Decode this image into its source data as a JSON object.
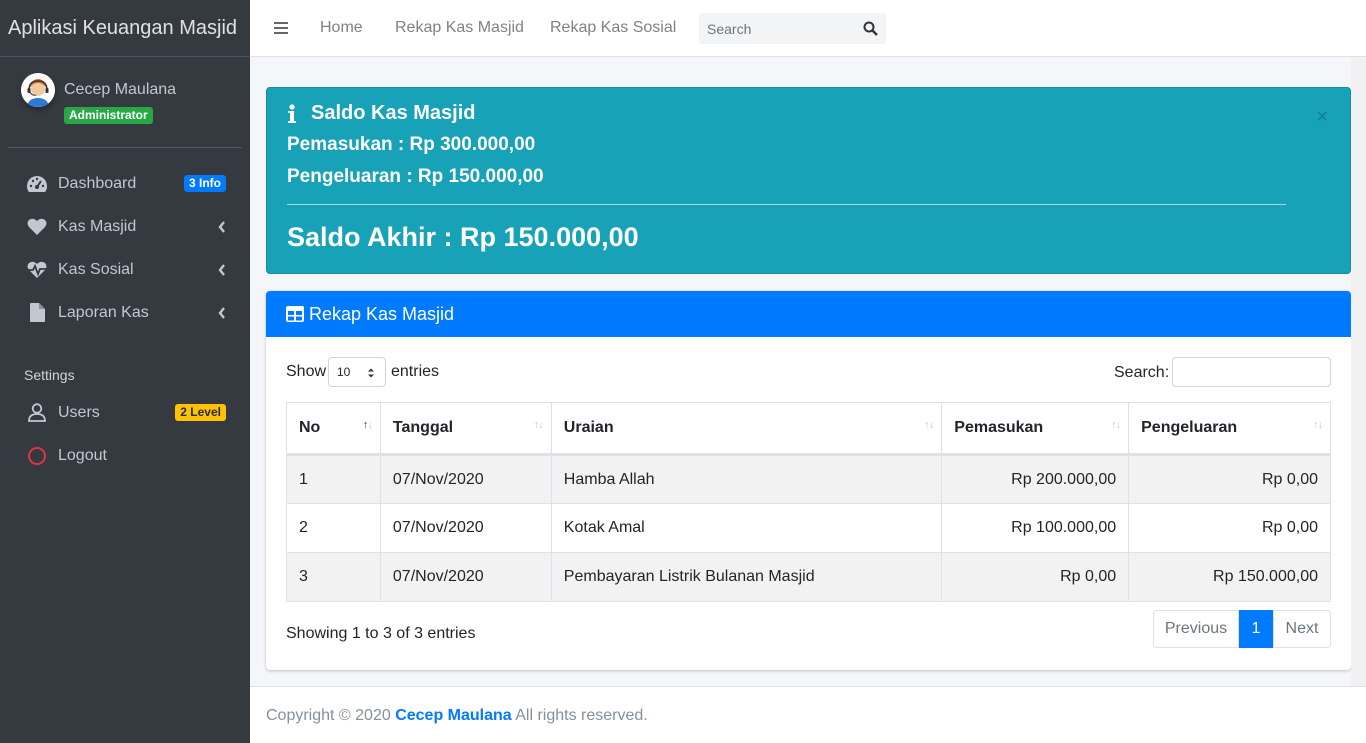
{
  "brand": {
    "title": "Aplikasi Keuangan Masjid"
  },
  "user": {
    "name": "Cecep Maulana",
    "role": "Administrator"
  },
  "sidebar": {
    "items": [
      {
        "label": "Dashboard",
        "icon": "tachometer-icon",
        "badge": "3 Info"
      },
      {
        "label": "Kas Masjid",
        "icon": "heart-icon"
      },
      {
        "label": "Kas Sosial",
        "icon": "heartbeat-icon"
      },
      {
        "label": "Laporan Kas",
        "icon": "file-icon"
      }
    ],
    "settings_header": "Settings",
    "settings_items": [
      {
        "label": "Users",
        "icon": "user-icon",
        "badge": "2 Level"
      },
      {
        "label": "Logout",
        "icon": "circle-icon"
      }
    ]
  },
  "topnav": {
    "links": [
      "Home",
      "Rekap Kas Masjid",
      "Rekap Kas Sosial"
    ],
    "search_placeholder": "Search"
  },
  "alert": {
    "title": "Saldo Kas Masjid",
    "pemasukan": "Pemasukan : Rp 300.000,00",
    "pengeluaran": "Pengeluaran : Rp 150.000,00",
    "saldo": "Saldo Akhir : Rp 150.000,00",
    "close": "×",
    "color": "#17a2b8"
  },
  "card": {
    "title": "Rekap Kas Masjid",
    "show_label": "Show",
    "page_length": "10",
    "entries_label": "entries",
    "search_label": "Search:",
    "columns": [
      "No",
      "Tanggal",
      "Uraian",
      "Pemasukan",
      "Pengeluaran"
    ],
    "rows": [
      {
        "no": "1",
        "tanggal": "07/Nov/2020",
        "uraian": "Hamba Allah",
        "pemasukan": "Rp 200.000,00",
        "pengeluaran": "Rp 0,00"
      },
      {
        "no": "2",
        "tanggal": "07/Nov/2020",
        "uraian": "Kotak Amal",
        "pemasukan": "Rp 100.000,00",
        "pengeluaran": "Rp 0,00"
      },
      {
        "no": "3",
        "tanggal": "07/Nov/2020",
        "uraian": "Pembayaran Listrik Bulanan Masjid",
        "pemasukan": "Rp 0,00",
        "pengeluaran": "Rp 150.000,00"
      }
    ],
    "info": "Showing 1 to 3 of 3 entries",
    "pagination": {
      "previous": "Previous",
      "current": "1",
      "next": "Next"
    },
    "header_color": "#007bff"
  },
  "footer": {
    "prefix": "Copyright © 2020",
    "author": "Cecep Maulana",
    "suffix": "All rights reserved."
  }
}
